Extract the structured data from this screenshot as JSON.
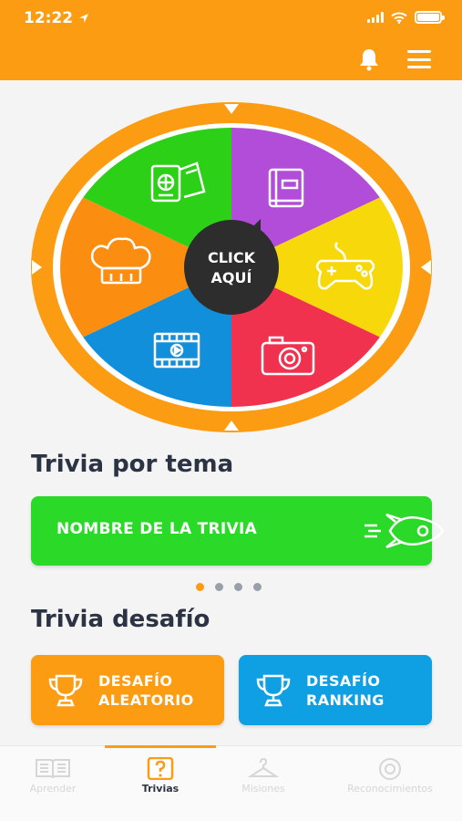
{
  "status_bar": {
    "time": "12:22"
  },
  "wheel": {
    "center_line1": "CLICK",
    "center_line2": "AQUÍ",
    "segments": [
      {
        "icon": "passport-tickets-icon",
        "color": "#2bd017"
      },
      {
        "icon": "book-icon",
        "color": "#b14dd9"
      },
      {
        "icon": "gamepad-icon",
        "color": "#f7d90b"
      },
      {
        "icon": "camera-icon",
        "color": "#f0324f"
      },
      {
        "icon": "film-icon",
        "color": "#128fdb"
      },
      {
        "icon": "chef-hat-icon",
        "color": "#fb8d10"
      }
    ]
  },
  "sections": {
    "topic_title": "Trivia por tema",
    "challenge_title": "Trivia desafío"
  },
  "trivia_card": {
    "label": "NOMBRE DE LA TRIVIA"
  },
  "pager": {
    "count": 4,
    "active": 1
  },
  "challenges": {
    "random": {
      "line1": "DESAFÍO",
      "line2": "ALEATORIO"
    },
    "ranking": {
      "line1": "DESAFÍO",
      "line2": "RANKING"
    }
  },
  "tabs": [
    {
      "label": "Aprender",
      "icon": "book-open-icon"
    },
    {
      "label": "Trivias",
      "icon": "question-icon",
      "active": true
    },
    {
      "label": "Misiones",
      "icon": "hanger-icon"
    },
    {
      "label": "Reconocimientos",
      "icon": "medal-icon"
    }
  ],
  "colors": {
    "accent": "#fb9c12",
    "trivia_card": "#2bd929",
    "ranking": "#0fa0e4",
    "title_text": "#2c3444"
  }
}
